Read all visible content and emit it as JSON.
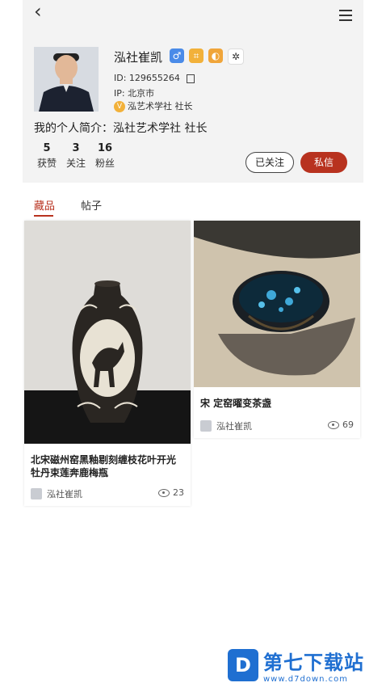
{
  "profile": {
    "name": "泓社崔凯",
    "id_line": "ID: 129655264",
    "ip_line": "IP: 北京市",
    "org": "泓艺术学社 社长",
    "intro": "我的个人简介：泓社艺术学社 社长",
    "badges": [
      "♂",
      "⌗",
      "◐",
      "✲"
    ]
  },
  "stats": [
    {
      "num": "5",
      "label": "获赞"
    },
    {
      "num": "3",
      "label": "关注"
    },
    {
      "num": "16",
      "label": "粉丝"
    }
  ],
  "buttons": {
    "followed": "已关注",
    "message": "私信"
  },
  "tabs": [
    {
      "label": "藏品"
    },
    {
      "label": "帖子"
    }
  ],
  "posts": [
    {
      "title": "北宋磁州窑黑釉剔刻缠枝花叶开光牡丹束莲奔鹿梅瓶",
      "author": "泓社崔凯",
      "views": "23"
    },
    {
      "title": "宋 定窑曜变茶盏",
      "author": "泓社崔凯",
      "views": "69"
    }
  ],
  "watermark": {
    "main": "第七下载站",
    "sub": "www.d7down.com",
    "logo": "D"
  },
  "icons": {
    "back": "‹",
    "menu": "menu-icon"
  }
}
